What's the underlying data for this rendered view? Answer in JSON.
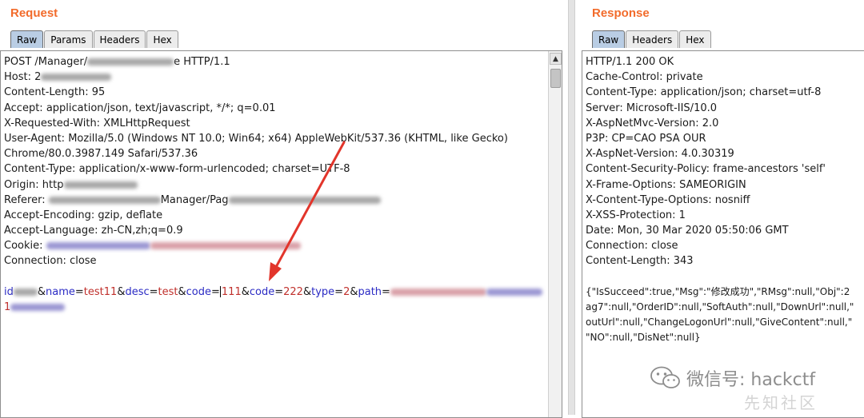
{
  "request": {
    "title": "Request",
    "tabs": [
      "Raw",
      "Params",
      "Headers",
      "Hex"
    ],
    "active_tab": "Raw",
    "lines": {
      "l0_a": "POST /Manager/",
      "l0_b": "e HTTP/1.1",
      "l1": "Host: 2",
      "l2": "Content-Length: 95",
      "l3": "Accept: application/json, text/javascript, */*; q=0.01",
      "l4": "X-Requested-With: XMLHttpRequest",
      "l5": "User-Agent: Mozilla/5.0 (Windows NT 10.0; Win64; x64) AppleWebKit/537.36 (KHTML, like Gecko)",
      "l6": "Chrome/80.0.3987.149 Safari/537.36",
      "l7": "Content-Type: application/x-www-form-urlencoded; charset=UTF-8",
      "l8": "Origin: http",
      "l9_a": "Referer: ",
      "l9_b": "Manager/Pag",
      "l10": "Accept-Encoding: gzip, deflate",
      "l11": "Accept-Language: zh-CN,zh;q=0.9",
      "l12": "Cookie: ",
      "l13": "Connection: close"
    },
    "body": {
      "p1": "id",
      "p2": "&",
      "p3": "name",
      "p4": "=",
      "p5": "test11",
      "p6": "&",
      "p7": "desc",
      "p8": "=",
      "p9": "test",
      "p10": "&",
      "p11": "code",
      "p12": "=",
      "p13": "111",
      "p14": "&",
      "p15": "code",
      "p16": "=",
      "p17": "222",
      "p18": "&",
      "p19": "type",
      "p20": "=",
      "p21": "2",
      "p22": "&",
      "p23": "path",
      "p24": "=",
      "line2": "1"
    }
  },
  "response": {
    "title": "Response",
    "tabs": [
      "Raw",
      "Headers",
      "Hex"
    ],
    "active_tab": "Raw",
    "lines": [
      "HTTP/1.1 200 OK",
      "Cache-Control: private",
      "Content-Type: application/json; charset=utf-8",
      "Server: Microsoft-IIS/10.0",
      "X-AspNetMvc-Version: 2.0",
      "P3P: CP=CAO PSA OUR",
      "X-AspNet-Version: 4.0.30319",
      "Content-Security-Policy: frame-ancestors 'self'",
      "X-Frame-Options: SAMEORIGIN",
      "X-Content-Type-Options: nosniff",
      "X-XSS-Protection: 1",
      "Date: Mon, 30 Mar 2020 05:50:06 GMT",
      "Connection: close",
      "Content-Length: 343",
      "",
      "{\"IsSucceed\":true,\"Msg\":\"修改成功\",\"RMsg\":null,\"Obj\":2",
      "ag7\":null,\"OrderID\":null,\"SoftAuth\":null,\"DownUrl\":null,\"",
      "outUrl\":null,\"ChangeLogonUrl\":null,\"GiveContent\":null,\"",
      "\"NO\":null,\"DisNet\":null}"
    ]
  },
  "watermark": {
    "wechat": "微信号: hackctf",
    "site": "先知社区"
  },
  "colors": {
    "title_orange": "#f26b2b",
    "active_tab": "#b9cde4",
    "param_blue": "#2b2bc4",
    "value_red": "#c0302c",
    "arrow_red": "#e2352b"
  },
  "icons": {
    "scroll_up": "▲",
    "scroll_down": "▼",
    "wechat": "wechat-logo-icon"
  }
}
